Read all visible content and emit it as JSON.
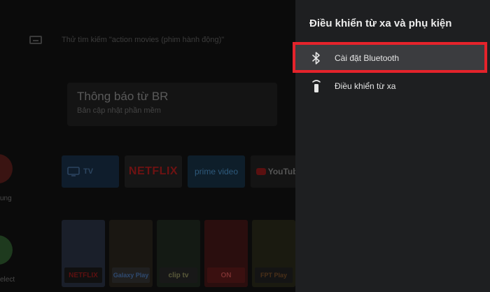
{
  "background": {
    "search_hint": "Thử tìm kiếm \"action movies (phim hành động)\"",
    "notification": {
      "title": "Thông báo từ BR",
      "subtitle": "Bản cập nhật phần mềm"
    },
    "side_labels": [
      "ung",
      "elect"
    ],
    "apps": [
      {
        "label": "TV"
      },
      {
        "label": "NETFLIX"
      },
      {
        "label": "prime video"
      },
      {
        "label": "YouTube"
      }
    ],
    "thumb_captions": [
      "NETFLIX",
      "Galaxy Play",
      "clip tv",
      "ON",
      "FPT Play"
    ]
  },
  "panel": {
    "title": "Điều khiển từ xa và phụ kiện",
    "items": [
      {
        "label": "Cài đặt Bluetooth",
        "icon": "bluetooth-icon",
        "focused": true
      },
      {
        "label": "Điều khiển từ xa",
        "icon": "remote-icon",
        "focused": false
      }
    ]
  },
  "colors": {
    "focus_outline": "#e5232b",
    "panel_background": "#1e1f21",
    "focused_item_background": "#3b3c3f"
  }
}
